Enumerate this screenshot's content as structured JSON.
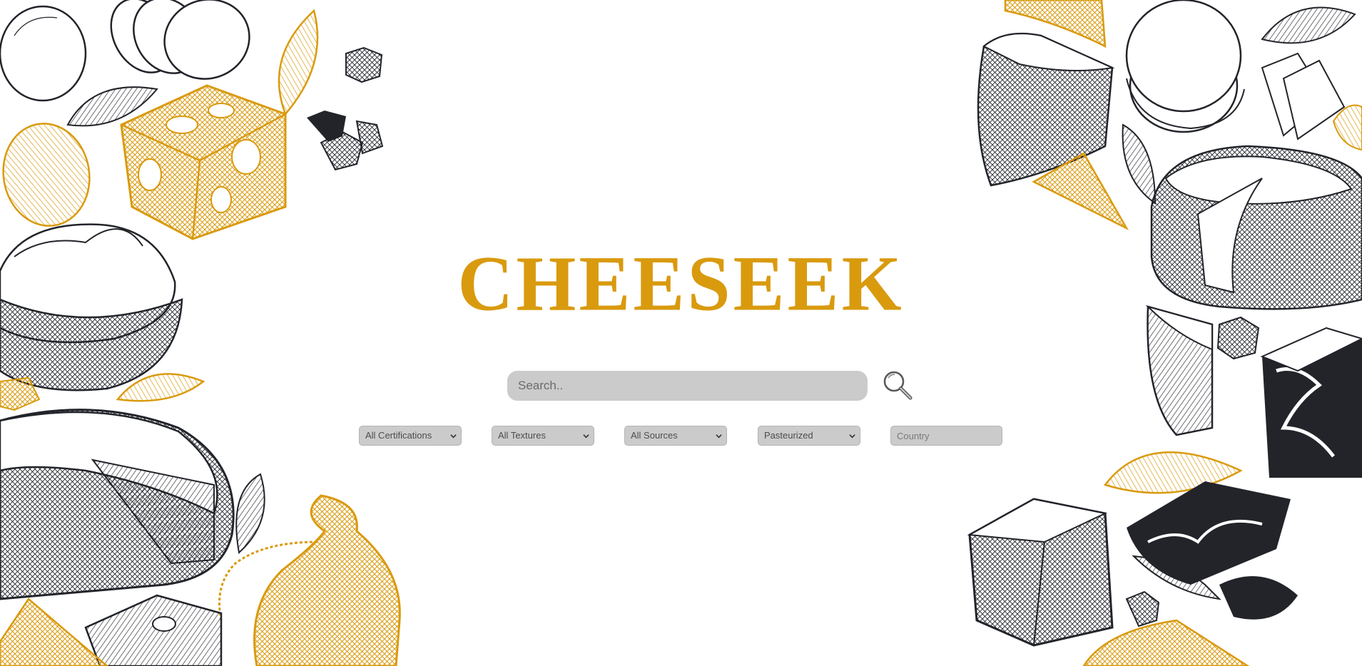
{
  "logo": {
    "text": "CHEESEEK",
    "color": "#d99a0e"
  },
  "search": {
    "placeholder": "Search..",
    "value": "",
    "button_icon": "magnifier-icon"
  },
  "filters": {
    "certifications": {
      "selected": "All Certifications"
    },
    "textures": {
      "selected": "All Textures"
    },
    "sources": {
      "selected": "All Sources"
    },
    "pasteurized": {
      "selected": "Pasteurized"
    },
    "country": {
      "placeholder": "Country",
      "value": ""
    }
  },
  "colors": {
    "accent": "#d99a0e",
    "ink": "#22242a",
    "field": "#cbcbcb",
    "background": "#ffffff"
  }
}
